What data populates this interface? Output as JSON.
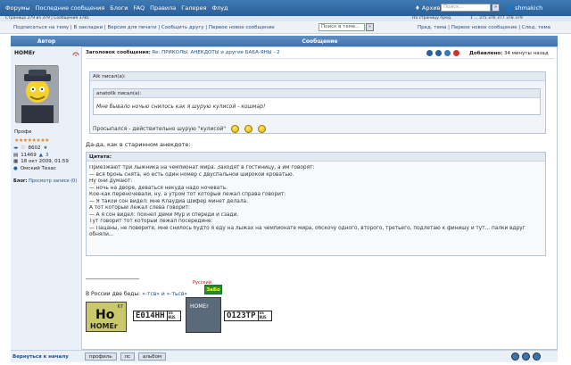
{
  "topbar": {
    "nav": [
      "Форумы",
      "Последние сообщения",
      "Блоги",
      "FAQ",
      "Правила",
      "Галерея",
      "Флуд"
    ],
    "archive": "Архив",
    "search_placeholder": "Поиск...",
    "search_go": "»",
    "user": "shmakich"
  },
  "pager": {
    "left": "Страница 379 из 379  |  Сообщения 3781",
    "mid": "На страницу пред.",
    "right": "1 ... 375 376 377 378 379"
  },
  "actions": {
    "links": "Подписаться на тему | В закладки | Версия для печати | Сообщить другу | Первое новое сообщение",
    "search_placeholder": "Поиск в теме...",
    "search_go": "»",
    "topic_nav": "Пред. тема | Первое новое сообщение | След. тема"
  },
  "header": {
    "author": "Автор",
    "message": "Сообщение"
  },
  "author": {
    "name": "HOMEr",
    "rank": "Профи",
    "stars": "★★★★★★★★",
    "messages": "8602",
    "rep": "11469",
    "badge_count": "3",
    "joined": "18 окт 2009, 01:59",
    "location": "Омский Техас",
    "blog_label": "Блог:",
    "blog_link": "Просмотр записи (0)"
  },
  "post": {
    "title_label": "Заголовок сообщения:",
    "topic": "Re: ПРИКОЛЫ, АНЕКДОТЫ и другие БАБА-ЯНЫ - 2",
    "added_label": "Добавлено:",
    "added": "34 минуты назад",
    "outer_quote_author": "Aik писал(а):",
    "inner_quote_author": "anatolik писал(а):",
    "inner_quote_text": "Мне бывало ночью снилось как я шурую кулисой - кошмар!",
    "outer_quote_text": "Просыпался - действительно шурую \"кулисой\"",
    "reply": "Да-да, как в старинном анекдоте:",
    "citation_label": "Цитата:",
    "citation_lines": [
      "Приезжают три лыжника на чемпионат мира. Заходят в гостиницу, а им говорят:",
      "— вся бронь снята, но есть один номер с двуспальной широкой кроватью.",
      "Ну они думают:",
      "— ночь на дворе, деваться некуда надо ночевать.",
      "Кое-как переночевали, ну, а утром тот который лежал справа говорит:",
      "— Я такой сон видел: мне Клаудиа Шифер минет делала.",
      "А тот который лежал слева говорит:",
      "— А я сон видел: похнел Деми Мур и спереди и сзади.",
      "Тут говорит тот который лежал посередине:",
      "— Пацаны, не поверите, мне снилось будто я еду на лыжах на чемпионате мира, обскочу одного, второго, третьего, подлетаю к финишу и тут... палки вдруг обняли..."
    ]
  },
  "signature": {
    "text_before": "В России две беды: ",
    "highlight": "«-тсв» и «-тьсв»",
    "ho_number": "67",
    "ho_text": "Ho",
    "ho_name": "HOMEr",
    "plate1": "E014HH",
    "plate1_region": "55 RUS",
    "plate2": "O123TP",
    "plate2_region": "55 RUS",
    "car_label": "HOMEr",
    "russian": "Русский",
    "badge": "ЗаБо"
  },
  "bottom": {
    "back": "Вернуться к началу",
    "buttons": [
      "профиль",
      "лс",
      "альбом"
    ]
  },
  "colors": {
    "topbar": "#2a5f98",
    "header": "#3f73ac",
    "link": "#1f4f86"
  }
}
